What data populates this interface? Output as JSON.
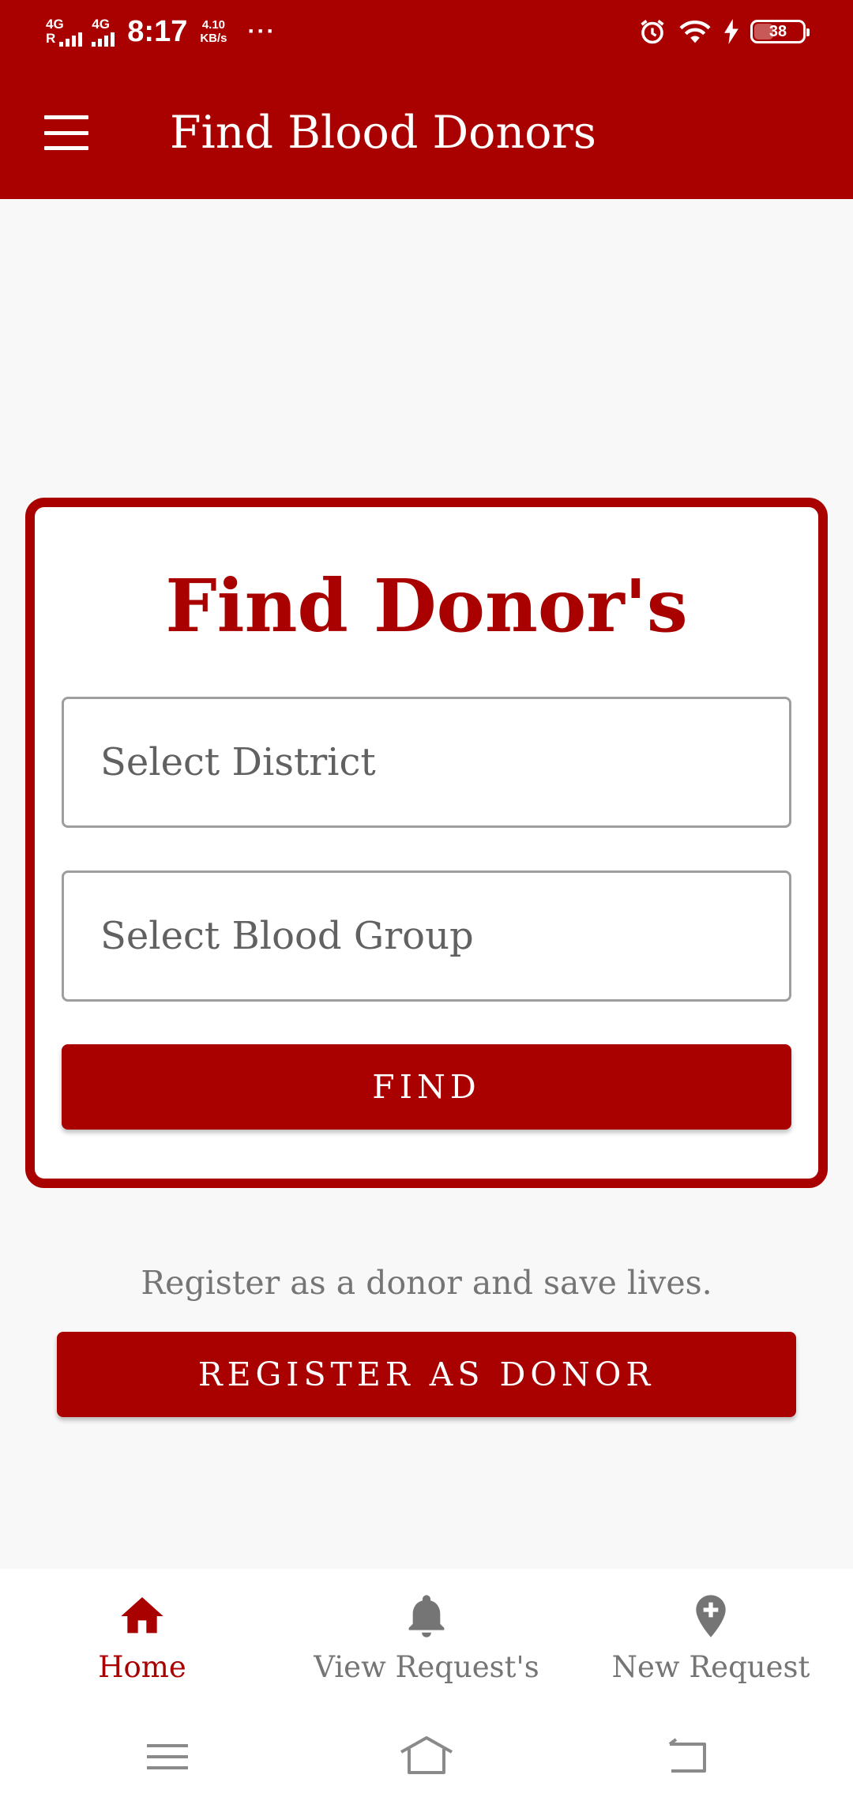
{
  "status_bar": {
    "signal1_type": "4G",
    "signal1_prefix": "R",
    "signal2_type": "4G",
    "time": "8:17",
    "speed_value": "4.10",
    "speed_unit": "KB/s",
    "more": "···",
    "battery": "38"
  },
  "app_bar": {
    "title": "Find Blood Donors",
    "menu_icon": "hamburger-menu-icon"
  },
  "card": {
    "title": "Find Donor's",
    "district_placeholder": "Select District",
    "blood_group_placeholder": "Select Blood Group",
    "find_label": "FIND"
  },
  "register": {
    "text": "Register as a donor and save lives.",
    "button_label": "REGISTER AS DONOR"
  },
  "bottom_nav": {
    "items": [
      {
        "label": "Home",
        "icon": "home-icon",
        "active": true
      },
      {
        "label": "View Request's",
        "icon": "bell-icon",
        "active": false
      },
      {
        "label": "New Request",
        "icon": "add-location-icon",
        "active": false
      }
    ]
  },
  "colors": {
    "primary": "#a90000",
    "inactive": "#757575",
    "background": "#f8f8f8"
  }
}
